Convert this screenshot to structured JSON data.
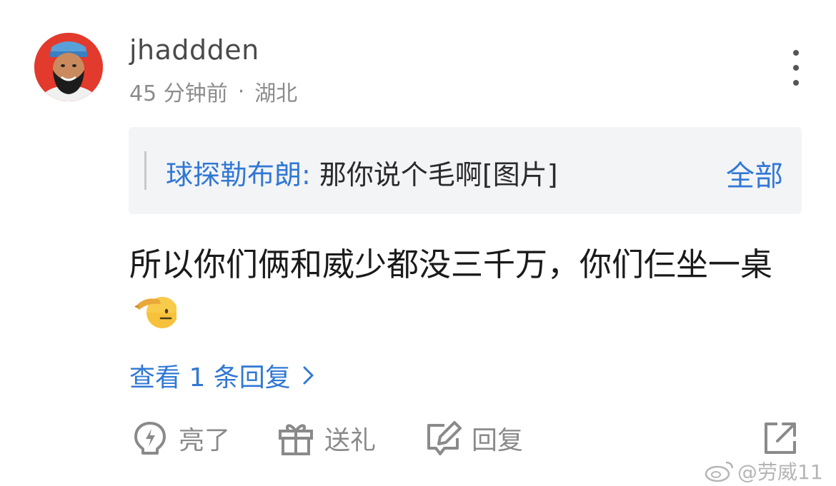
{
  "comment": {
    "username": "jhaddden",
    "time": "45 分钟前",
    "separator": "·",
    "location": "湖北",
    "quote": {
      "author": "球探勒布朗:",
      "text": " 那你说个毛啊[图片]",
      "all_label": "全部"
    },
    "body": "所以你们俩和威少都没三千万，你们仨坐一桌",
    "view_replies": "查看 1 条回复"
  },
  "actions": {
    "like_label": "亮了",
    "gift_label": "送礼",
    "reply_label": "回复"
  },
  "watermark": {
    "text": "@劳威11"
  },
  "colors": {
    "link_blue": "#3178d4",
    "quote_bg": "#f3f4f6",
    "meta_gray": "#8c8c8c",
    "avatar_red": "#e23a2c"
  },
  "icons": [
    "avatar",
    "more-vertical-icon",
    "chevron-right-icon",
    "lightbulb-icon",
    "gift-icon",
    "reply-edit-icon",
    "share-external-icon",
    "weibo-logo-icon",
    "saluting-face-emoji"
  ]
}
